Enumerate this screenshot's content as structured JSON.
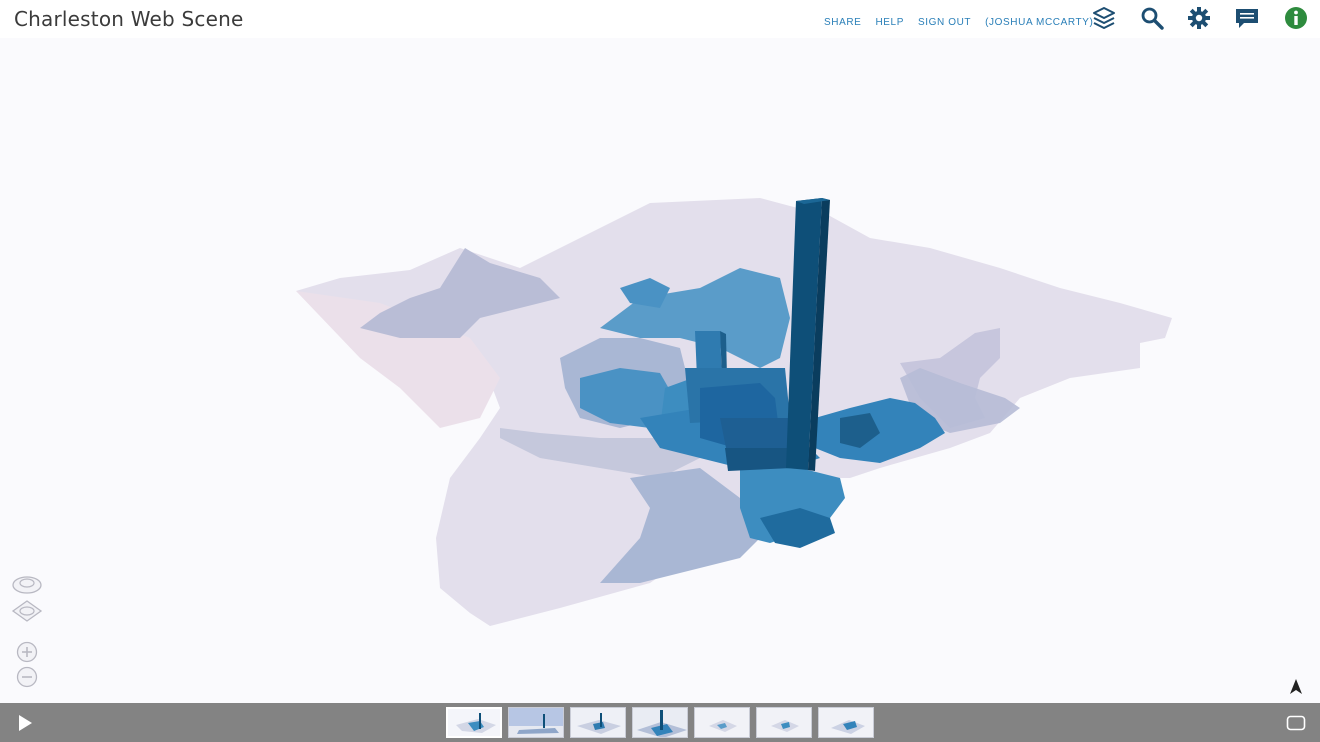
{
  "app": {
    "title": "Charleston Web Scene"
  },
  "header": {
    "links": [
      {
        "label": "SHARE"
      },
      {
        "label": "HELP"
      },
      {
        "label": "SIGN OUT"
      },
      {
        "label": "(JOSHUA MCCARTY)"
      }
    ],
    "icons": [
      "layers-icon",
      "search-icon",
      "gear-icon",
      "comment-icon",
      "info-icon"
    ]
  },
  "colors": {
    "link": "#2a7fb8",
    "accent_dark": "#1d4e72",
    "info": "#2e8b3e",
    "bottom_bar": "#838383",
    "region_light": "#e3dfec",
    "region_mid": "#a9b7d4",
    "region_blue": "#3d8dc0",
    "region_dark": "#0e4f78"
  },
  "scene": {
    "nav_controls": [
      "pan-icon",
      "orbit-icon",
      "zoom-in-icon",
      "zoom-out-icon",
      "compass-icon"
    ]
  },
  "slides": {
    "count": 7,
    "active_index": 0
  },
  "bottom_bar": {
    "controls": [
      "play-icon",
      "fullscreen-icon"
    ]
  }
}
